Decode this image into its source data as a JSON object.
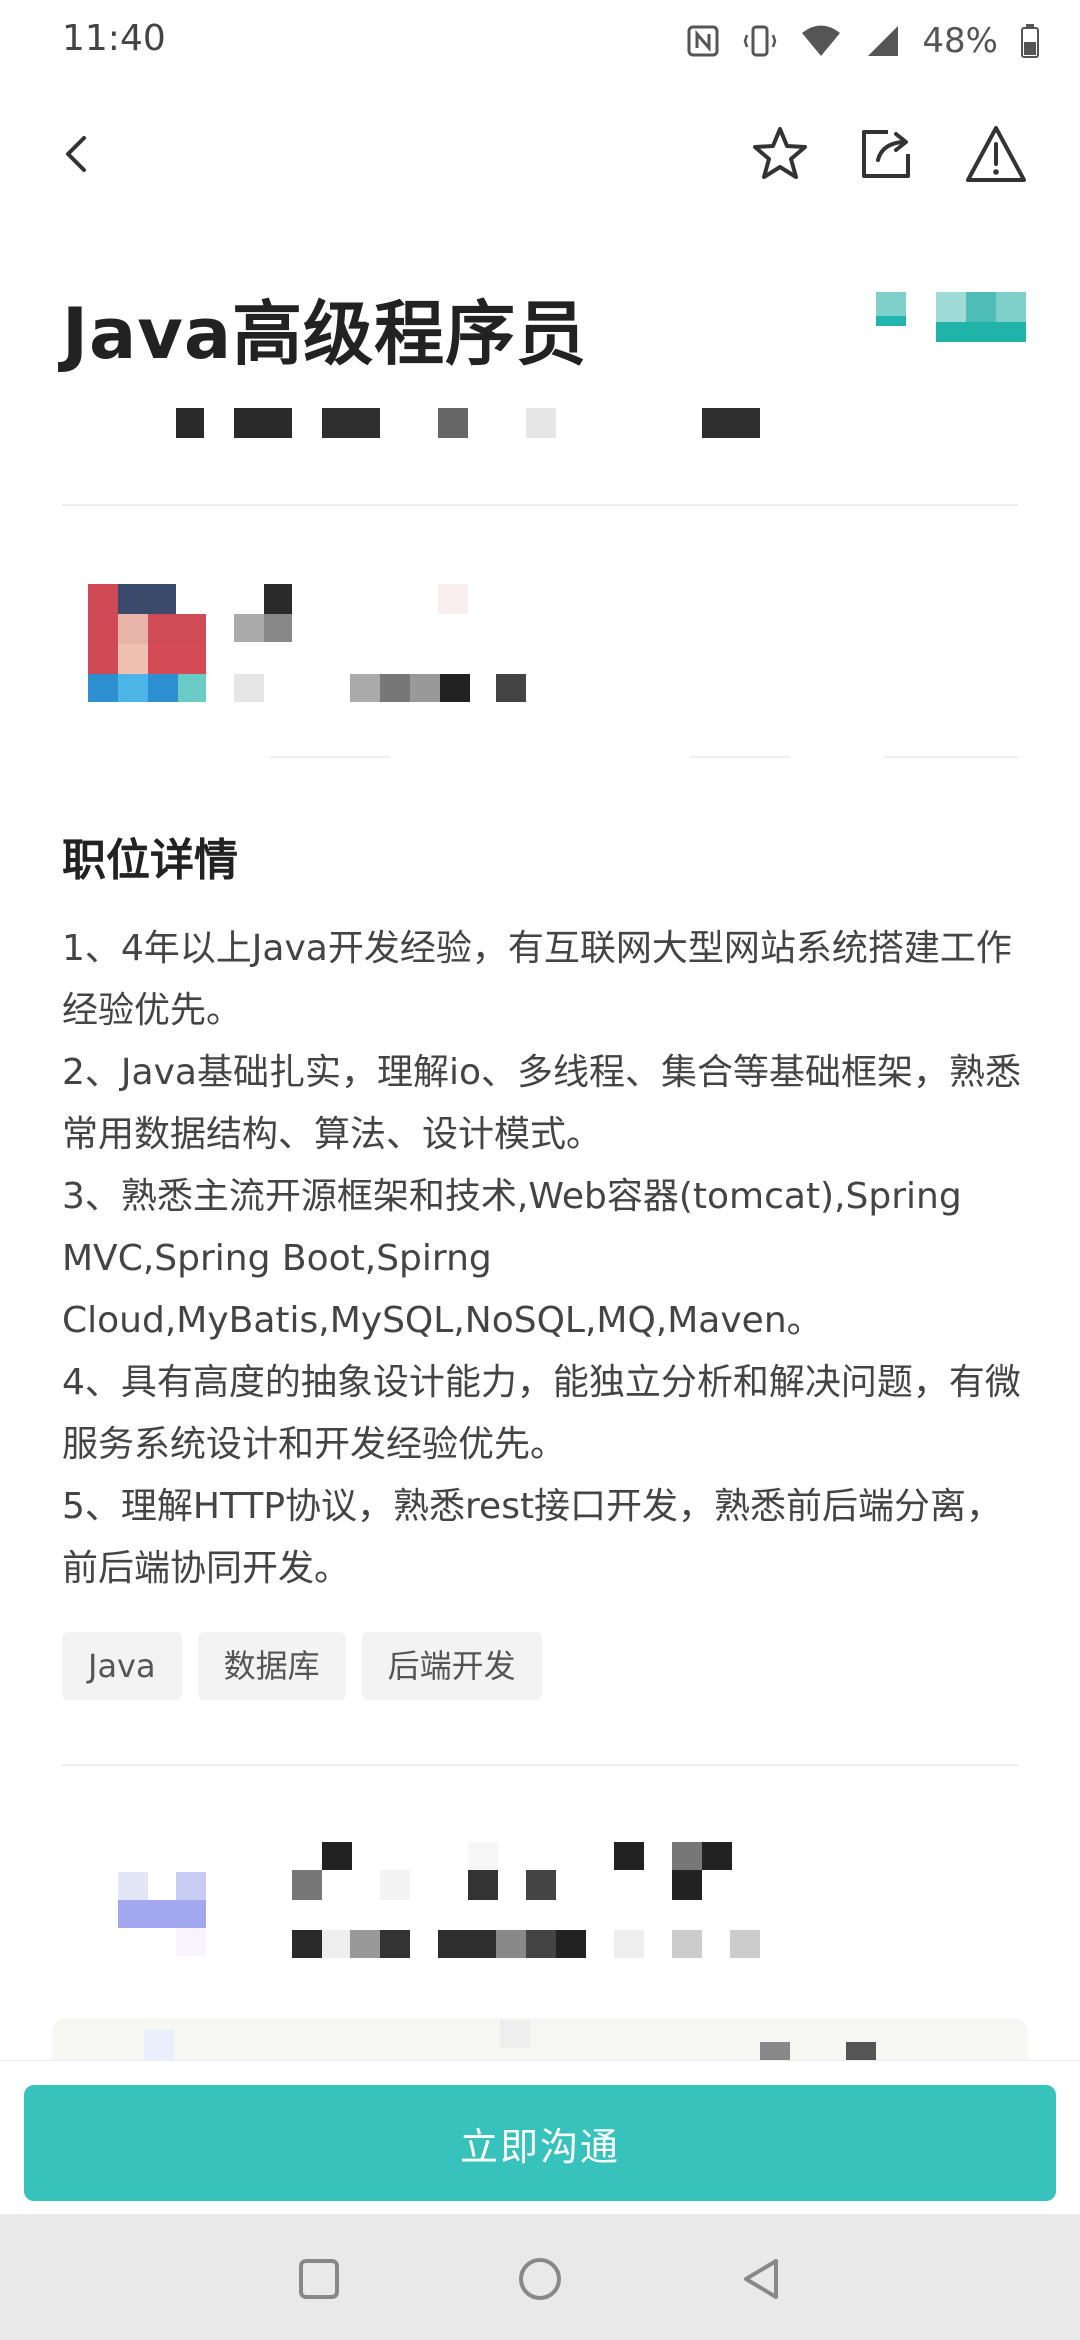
{
  "status_bar": {
    "time": "11:40",
    "battery": "48%",
    "icons": [
      "nfc-icon",
      "vibrate-icon",
      "wifi-icon",
      "signal-icon",
      "battery-icon"
    ]
  },
  "header": {
    "icons": [
      "back-icon",
      "star-icon",
      "share-icon",
      "report-icon"
    ]
  },
  "job": {
    "title": "Java高级程序员"
  },
  "details": {
    "section_title": "职位详情",
    "lines": [
      "1、4年以上Java开发经验，有互联网大型网站系统搭建工作经验优先。",
      "2、Java基础扎实，理解io、多线程、集合等基础框架，熟悉常用数据结构、算法、设计模式。",
      "3、熟悉主流开源框架和技术,Web容器(tomcat),Spring MVC,Spring Boot,Spirng Cloud,MyBatis,MySQL,NoSQL,MQ,Maven。",
      "4、具有高度的抽象设计能力，能独立分析和解决问题，有微服务系统设计和开发经验优先。",
      "5、理解HTTP协议，熟悉rest接口开发，熟悉前后端分离，前后端协同开发。"
    ],
    "tags": [
      "Java",
      "数据库",
      "后端开发"
    ]
  },
  "actions": {
    "chat_button": "立即沟通"
  },
  "nav_bar": {
    "icons": [
      "recent-apps-icon",
      "home-icon",
      "back-nav-icon"
    ]
  },
  "colors": {
    "accent": "#37c2bb",
    "text": "#222222",
    "muted": "#444444",
    "tag_bg": "#f3f3f3"
  }
}
